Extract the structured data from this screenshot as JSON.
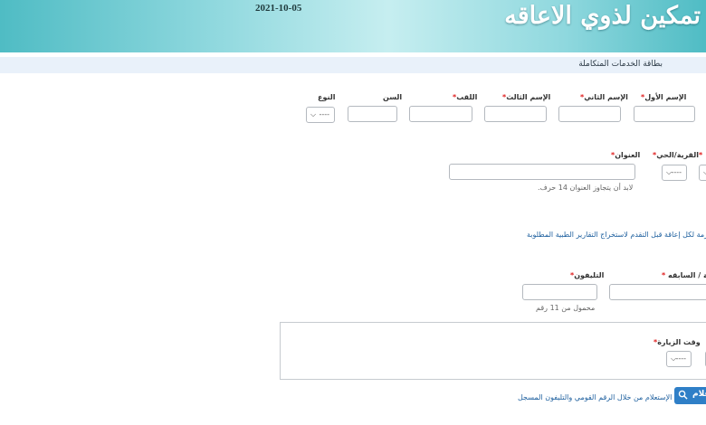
{
  "header": {
    "title": "تمكين لذوي الاعاقه",
    "date": "2021-10-05"
  },
  "breadcrumb": "بطاقة الخدمات المتكاملة",
  "personal": {
    "first_name_label": "الإسم الأول",
    "second_name_label": "الإسم الثاني",
    "third_name_label": "الإسم الثالث",
    "surname_label": "اللقب",
    "age_label": "السن",
    "gender_label": "النوع",
    "gender_value": "----"
  },
  "address": {
    "prev_field_required_mark": "*",
    "village_label": "القرية/الحي",
    "village_value": "----",
    "address_label": "العنوان",
    "address_hint": "لابد أن يتجاوز العنوان 14 حرف.",
    "notice": "اللازمة لكل إعاقة قبل التقدم لاستخراج التقارير الطبية المطلوبة"
  },
  "contact": {
    "card_label": "ليقة / السابقه",
    "phone_label": "التليفون",
    "phone_hint": "محمول من 11 رقم"
  },
  "visit": {
    "time_label": "وقت الزيارة",
    "time_value": "----"
  },
  "inquiry": {
    "button_label": "علام",
    "description": "الإستعلام من خلال الرقم القومي والتليفون المسجل"
  },
  "required_mark": "*",
  "colors": {
    "header_teal": "#4fbcc4",
    "link_blue": "#1d5f9e",
    "button_blue": "#2f7fc7",
    "required_red": "#e02020"
  }
}
